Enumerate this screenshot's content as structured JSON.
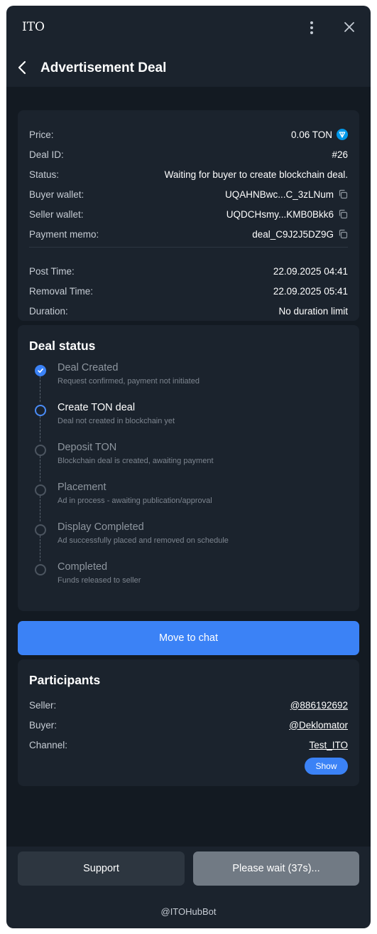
{
  "window": {
    "app_name": "ITO",
    "menu_icon": "kebab-menu-icon",
    "close_icon": "close-icon"
  },
  "header": {
    "back_icon": "chevron-left-icon",
    "title": "Advertisement Deal"
  },
  "deal_info": {
    "price": {
      "label": "Price:",
      "value": "0.06 TON",
      "icon": "ton-icon"
    },
    "deal_id": {
      "label": "Deal ID:",
      "value": "#26"
    },
    "status": {
      "label": "Status:",
      "value": "Waiting for buyer to create blockchain deal."
    },
    "buyer_wallet": {
      "label": "Buyer wallet:",
      "value": "UQAHNBwc...C_3zLNum",
      "icon": "copy-icon"
    },
    "seller_wallet": {
      "label": "Seller wallet:",
      "value": "UQDCHsmy...KMB0Bkk6",
      "icon": "copy-icon"
    },
    "payment_memo": {
      "label": "Payment memo:",
      "value": "deal_C9J2J5DZ9G",
      "icon": "copy-icon"
    },
    "post_time": {
      "label": "Post Time:",
      "value": "22.09.2025 04:41"
    },
    "removal_time": {
      "label": "Removal Time:",
      "value": "22.09.2025 05:41"
    },
    "duration": {
      "label": "Duration:",
      "value": "No duration limit"
    }
  },
  "deal_status": {
    "title": "Deal status",
    "steps": [
      {
        "title": "Deal Created",
        "subtitle": "Request confirmed, payment not initiated",
        "state": "done"
      },
      {
        "title": "Create TON deal",
        "subtitle": "Deal not created in blockchain yet",
        "state": "active"
      },
      {
        "title": "Deposit TON",
        "subtitle": "Blockchain deal is created, awaiting payment",
        "state": "pending"
      },
      {
        "title": "Placement",
        "subtitle": "Ad in process - awaiting publication/approval",
        "state": "pending"
      },
      {
        "title": "Display Completed",
        "subtitle": "Ad successfully placed and removed on schedule",
        "state": "pending"
      },
      {
        "title": "Completed",
        "subtitle": "Funds released to seller",
        "state": "pending"
      }
    ]
  },
  "actions": {
    "move_to_chat": "Move to chat"
  },
  "participants": {
    "title": "Participants",
    "seller": {
      "label": "Seller:",
      "value": "@886192692"
    },
    "buyer": {
      "label": "Buyer:",
      "value": "@Deklomator"
    },
    "channel": {
      "label": "Channel:",
      "value": "Test_ITO"
    },
    "show_label": "Show"
  },
  "footer": {
    "support_label": "Support",
    "wait_label": "Please wait (37s)...",
    "bot_name": "@ITOHubBot"
  },
  "colors": {
    "window_bg": "#1b232d",
    "content_bg": "#131a22",
    "accent": "#3b82f6",
    "link": "#5aa9f8",
    "disabled_button": "#717a84"
  }
}
